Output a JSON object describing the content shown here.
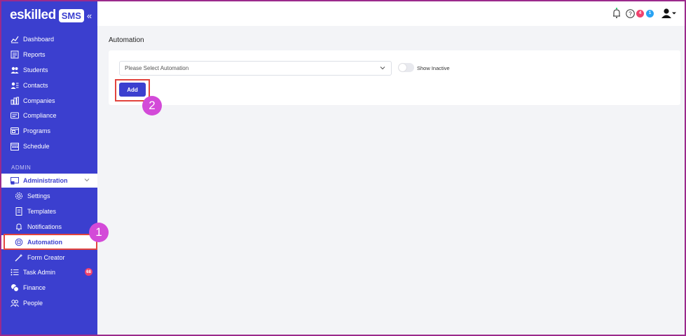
{
  "brand": {
    "name": "eskilled",
    "badge": "SMS",
    "collapse_glyph": "«"
  },
  "sidebar": {
    "items": [
      {
        "label": "Dashboard",
        "icon": "chart-line-icon"
      },
      {
        "label": "Reports",
        "icon": "report-icon"
      },
      {
        "label": "Students",
        "icon": "students-icon"
      },
      {
        "label": "Contacts",
        "icon": "contacts-icon"
      },
      {
        "label": "Companies",
        "icon": "companies-icon"
      },
      {
        "label": "Compliance",
        "icon": "compliance-icon"
      },
      {
        "label": "Programs",
        "icon": "programs-icon"
      },
      {
        "label": "Schedule",
        "icon": "schedule-icon"
      }
    ],
    "section_label": "ADMIN",
    "admin": {
      "label": "Administration",
      "icon": "administration-icon"
    },
    "admin_items": [
      {
        "label": "Settings",
        "icon": "settings-icon"
      },
      {
        "label": "Templates",
        "icon": "templates-icon"
      },
      {
        "label": "Notifications",
        "icon": "bell-icon"
      },
      {
        "label": "Automation",
        "icon": "automation-icon"
      },
      {
        "label": "Form Creator",
        "icon": "wand-icon"
      }
    ],
    "bottom_items": [
      {
        "label": "Task Admin",
        "icon": "task-list-icon",
        "badge": "68"
      },
      {
        "label": "Finance",
        "icon": "finance-icon"
      },
      {
        "label": "People",
        "icon": "people-icon"
      }
    ]
  },
  "header": {
    "help_count": "4",
    "notif_count": "1"
  },
  "main": {
    "title": "Automation",
    "select_placeholder": "Please Select Automation",
    "toggle_label": "Show Inactive",
    "add_label": "Add"
  },
  "callouts": {
    "one": "1",
    "two": "2"
  },
  "colors": {
    "primary": "#3b3fcf",
    "highlight": "#e2443e",
    "callout": "#d34ad8",
    "badge_red": "#f0426d",
    "badge_blue": "#29a3f3"
  }
}
